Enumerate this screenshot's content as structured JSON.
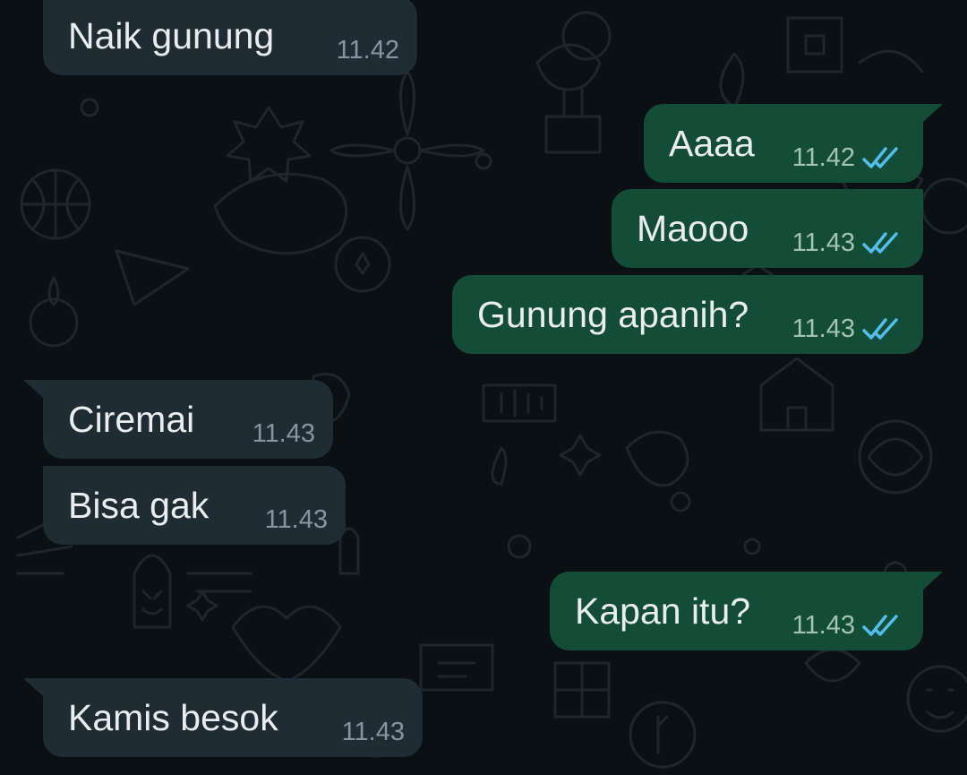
{
  "theme": {
    "background": "#0b1014",
    "incoming_bubble": "#202c33",
    "outgoing_bubble": "#144d37",
    "text": "#e9edef",
    "read_tick": "#53bdeb"
  },
  "messages": [
    {
      "direction": "incoming",
      "text": "Naik gunung",
      "time": "11.42"
    },
    {
      "direction": "outgoing",
      "text": "Aaaa",
      "time": "11.42",
      "status": "read-double-tick-icon"
    },
    {
      "direction": "outgoing",
      "text": "Maooo",
      "time": "11.43",
      "status": "read-double-tick-icon"
    },
    {
      "direction": "outgoing",
      "text": "Gunung apanih?",
      "time": "11.43",
      "status": "read-double-tick-icon"
    },
    {
      "direction": "incoming",
      "text": "Ciremai",
      "time": "11.43"
    },
    {
      "direction": "incoming",
      "text": "Bisa gak",
      "time": "11.43"
    },
    {
      "direction": "outgoing",
      "text": "Kapan itu?",
      "time": "11.43",
      "status": "read-double-tick-icon"
    },
    {
      "direction": "incoming",
      "text": "Kamis besok",
      "time": "11.43"
    }
  ]
}
